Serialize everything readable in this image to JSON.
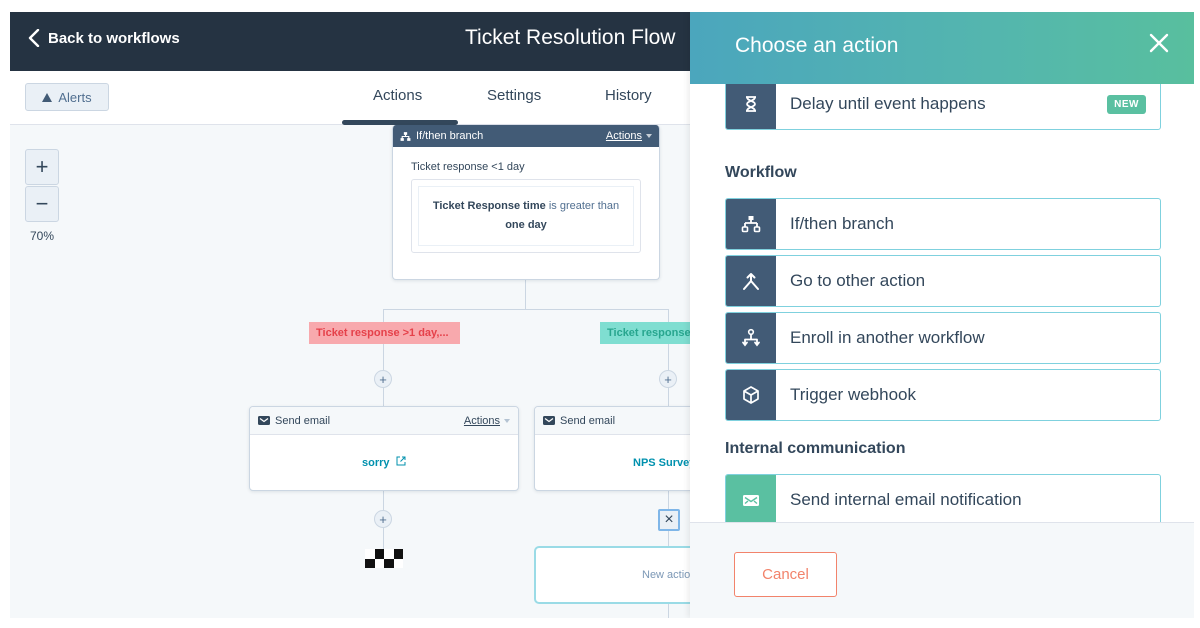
{
  "topbar": {
    "back_label": "Back to workflows",
    "title": "Ticket Resolution Flow"
  },
  "subnav": {
    "alerts_label": "Alerts",
    "tabs": [
      {
        "label": "Actions",
        "active": true
      },
      {
        "label": "Settings",
        "active": false
      },
      {
        "label": "History",
        "active": false
      }
    ]
  },
  "canvas": {
    "zoom_in": "+",
    "zoom_out": "−",
    "zoom_level": "70%",
    "branch_node": {
      "type_label": "If/then branch",
      "actions_label": "Actions",
      "branch_name": "Ticket response <1 day",
      "condition_property": "Ticket Response time",
      "condition_operator": " is greater than ",
      "condition_value": "one day"
    },
    "branch_labels": [
      {
        "label": "Ticket response >1 day,...",
        "color": "#f2545b",
        "bg": "#f8a9ad"
      },
      {
        "label": "Ticket response",
        "color": "#00a4bd",
        "bg": "#7fded1"
      }
    ],
    "email_nodes": [
      {
        "type_label": "Send email",
        "actions_label": "Actions",
        "email_name": "sorry"
      },
      {
        "type_label": "Send email",
        "actions_label": "",
        "email_name": "NPS Survey"
      }
    ],
    "plus": "+",
    "remove": "×",
    "new_action_label": "New action"
  },
  "panel": {
    "title": "Choose an action",
    "sections": [
      {
        "title": "",
        "items": [
          {
            "label": "Delay until event happens",
            "icon": "hourglass-icon",
            "badge": "NEW"
          }
        ]
      },
      {
        "title": "Workflow",
        "items": [
          {
            "label": "If/then branch",
            "icon": "branch-icon"
          },
          {
            "label": "Go to other action",
            "icon": "merge-arrow-icon"
          },
          {
            "label": "Enroll in another workflow",
            "icon": "enroll-workflow-icon"
          },
          {
            "label": "Trigger webhook",
            "icon": "cube-icon"
          }
        ]
      },
      {
        "title": "Internal communication",
        "items": [
          {
            "label": "Send internal email notification",
            "icon": "envelope-icon"
          }
        ]
      }
    ],
    "cancel_label": "Cancel"
  },
  "colors": {
    "topbar": "#253342",
    "accent_teal": "#00a4bd",
    "panel_gradient_start": "#4ba6bd",
    "panel_gradient_end": "#58bf9e",
    "icon_dark": "#425b76",
    "icon_green": "#5ac0a1",
    "cancel": "#f2836b"
  }
}
